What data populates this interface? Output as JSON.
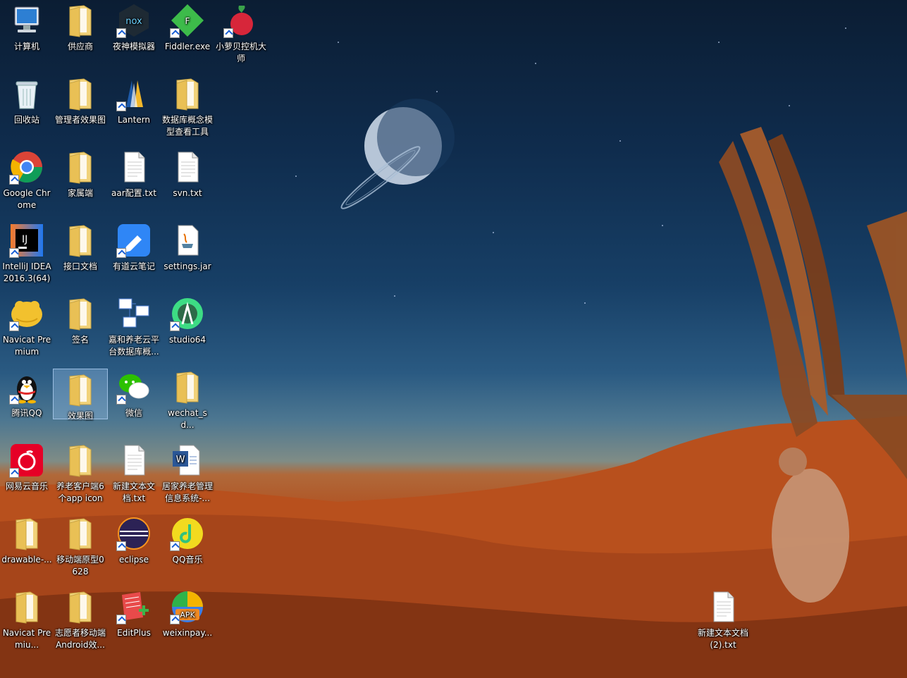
{
  "desktop": {
    "icons": [
      {
        "label": "计算机",
        "icon": "computer-icon",
        "shortcut": false
      },
      {
        "label": "供应商",
        "icon": "folder-icon",
        "shortcut": false
      },
      {
        "label": "夜神模拟器",
        "icon": "nox-icon",
        "shortcut": true
      },
      {
        "label": "Fiddler.exe",
        "icon": "fiddler-icon",
        "shortcut": true
      },
      {
        "label": "小萝贝控机大师",
        "icon": "radish-icon",
        "shortcut": true
      },
      {
        "label": "回收站",
        "icon": "recycle-bin-icon",
        "shortcut": false
      },
      {
        "label": "管理者效果图",
        "icon": "folder-icon",
        "shortcut": false
      },
      {
        "label": "Lantern",
        "icon": "lantern-icon",
        "shortcut": true
      },
      {
        "label": "数据库概念模型查看工具",
        "icon": "folder-icon",
        "shortcut": false
      },
      {
        "label": "Google Chrome",
        "icon": "chrome-icon",
        "shortcut": true
      },
      {
        "label": "家属端",
        "icon": "folder-icon",
        "shortcut": false
      },
      {
        "label": "aar配置.txt",
        "icon": "text-file-icon",
        "shortcut": false
      },
      {
        "label": "svn.txt",
        "icon": "text-file-icon",
        "shortcut": false
      },
      {
        "label": "IntelliJ IDEA 2016.3(64)",
        "icon": "intellij-icon",
        "shortcut": true
      },
      {
        "label": "接口文档",
        "icon": "folder-icon",
        "shortcut": false
      },
      {
        "label": "有道云笔记",
        "icon": "youdao-note-icon",
        "shortcut": true
      },
      {
        "label": "settings.jar",
        "icon": "jar-file-icon",
        "shortcut": false
      },
      {
        "label": "Navicat Premium",
        "icon": "navicat-icon",
        "shortcut": true
      },
      {
        "label": "签名",
        "icon": "folder-icon",
        "shortcut": false
      },
      {
        "label": "嘉和养老云平台数据库概...",
        "icon": "database-diagram-icon",
        "shortcut": false
      },
      {
        "label": "studio64",
        "icon": "android-studio-icon",
        "shortcut": true
      },
      {
        "label": "腾讯QQ",
        "icon": "qq-penguin-icon",
        "shortcut": true
      },
      {
        "label": "效果图",
        "icon": "folder-icon",
        "shortcut": false,
        "selected": true
      },
      {
        "label": "微信",
        "icon": "wechat-icon",
        "shortcut": true
      },
      {
        "label": "wechat_sd...",
        "icon": "folder-icon",
        "shortcut": false
      },
      {
        "label": "网易云音乐",
        "icon": "netease-music-icon",
        "shortcut": true
      },
      {
        "label": "养老客户端6个app icon",
        "icon": "folder-icon",
        "shortcut": false
      },
      {
        "label": "新建文本文档.txt",
        "icon": "text-file-icon",
        "shortcut": false
      },
      {
        "label": "居家养老管理信息系统-...",
        "icon": "word-doc-icon",
        "shortcut": false
      },
      {
        "label": "drawable-...",
        "icon": "folder-icon",
        "shortcut": false
      },
      {
        "label": "移动端原型0628",
        "icon": "folder-icon",
        "shortcut": false
      },
      {
        "label": "eclipse",
        "icon": "eclipse-icon",
        "shortcut": true
      },
      {
        "label": "QQ音乐",
        "icon": "qq-music-icon",
        "shortcut": true
      },
      {
        "label": "Navicat Premiu...",
        "icon": "folder-icon",
        "shortcut": false
      },
      {
        "label": "志愿者移动端Android效...",
        "icon": "folder-icon",
        "shortcut": false
      },
      {
        "label": "EditPlus",
        "icon": "editplus-icon",
        "shortcut": true
      },
      {
        "label": "weixinpay...",
        "icon": "apk-icon",
        "shortcut": true
      },
      {
        "label": "新建文本文档 (2).txt",
        "icon": "text-file-icon",
        "shortcut": false
      }
    ]
  },
  "colors": {
    "selection": "#a0c8f0",
    "label_text": "#ffffff"
  }
}
